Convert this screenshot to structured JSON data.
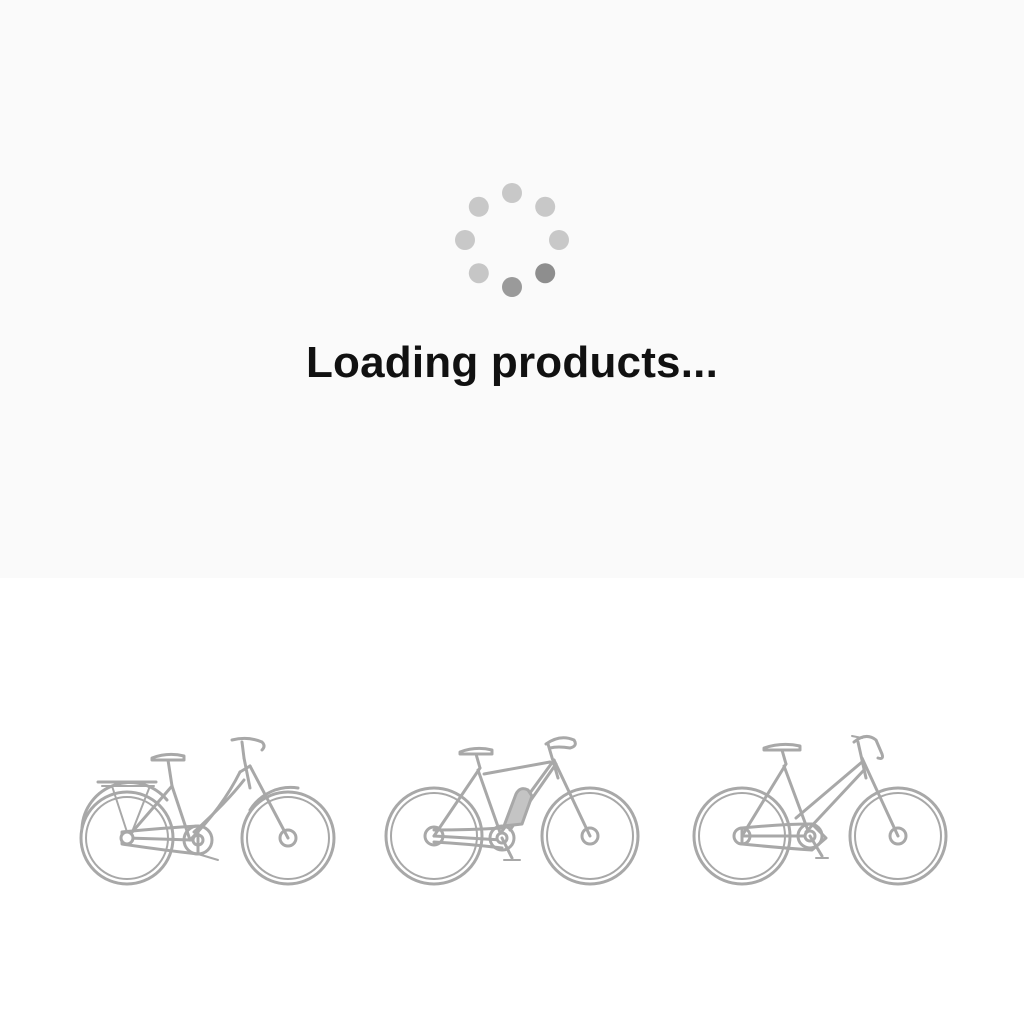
{
  "loading": {
    "message": "Loading products...",
    "spinner_dot_colors": [
      "#c8c8c8",
      "#c8c8c8",
      "#c8c8c8",
      "#8e8e8e",
      "#9a9a9a",
      "#c6c6c6",
      "#c8c8c8",
      "#c8c8c8"
    ],
    "panel_background": "#fafafa",
    "text_color": "#111111"
  },
  "products": [
    {
      "icon": "city-bike-icon",
      "kind": "step-through bicycle with rear rack"
    },
    {
      "icon": "e-bike-icon",
      "kind": "electric bicycle with frame battery"
    },
    {
      "icon": "trekking-bike-icon",
      "kind": "step-through trekking bicycle"
    }
  ],
  "colors": {
    "bike_line": "#a8a8a8",
    "page_background": "#ffffff"
  }
}
